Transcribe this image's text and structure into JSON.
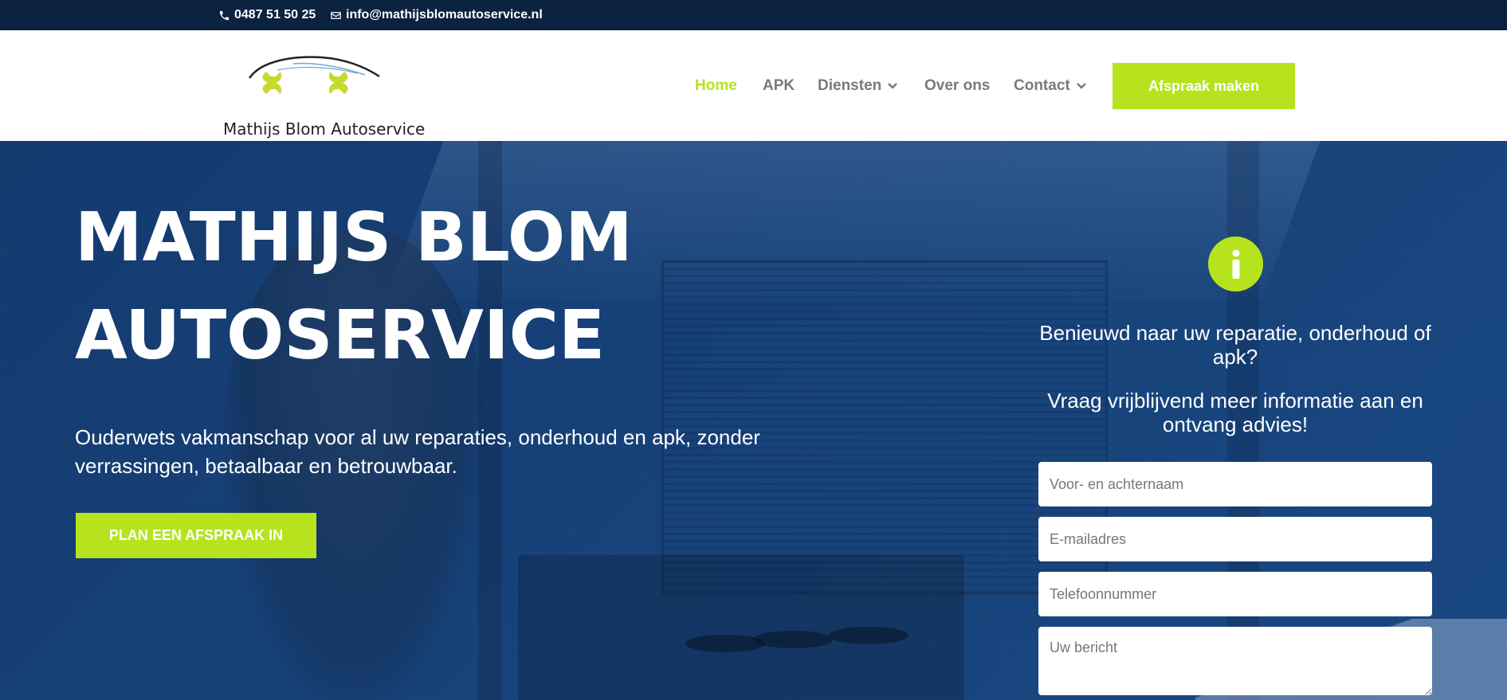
{
  "topbar": {
    "phone": "0487 51 50 25",
    "email": "info@mathijsblomautoservice.nl"
  },
  "header": {
    "logo_text": "Mathijs Blom Autoservice",
    "nav": {
      "home": "Home",
      "apk": "APK",
      "diensten": "Diensten",
      "over": "Over ons",
      "contact": "Contact"
    },
    "cta": "Afspraak maken"
  },
  "hero": {
    "title_line1": "MATHIJS BLOM",
    "title_line2": "AUTOSERVICE",
    "subtitle": "Ouderwets vakmanschap voor al uw reparaties, onderhoud en apk, zonder verrassingen, betaalbaar en betrouwbaar.",
    "cta": "PLAN EEN AFSPRAAK IN"
  },
  "form": {
    "heading": "Benieuwd naar uw reparatie, onderhoud of apk?",
    "heading2": "Vraag vrijblijvend meer informatie aan en ontvang advies!",
    "placeholders": {
      "name": "Voor- en achternaam",
      "email": "E-mailadres",
      "phone": "Telefoonnummer",
      "message": "Uw bericht"
    }
  },
  "colors": {
    "accent": "#b6e31e",
    "topbar": "#0b2240",
    "nav_text": "#7a7a7a",
    "hero_overlay": "#1c4478"
  },
  "icons": [
    "phone-icon",
    "envelope-icon",
    "chevron-down-icon",
    "info-icon",
    "logo-wrench-icon"
  ]
}
